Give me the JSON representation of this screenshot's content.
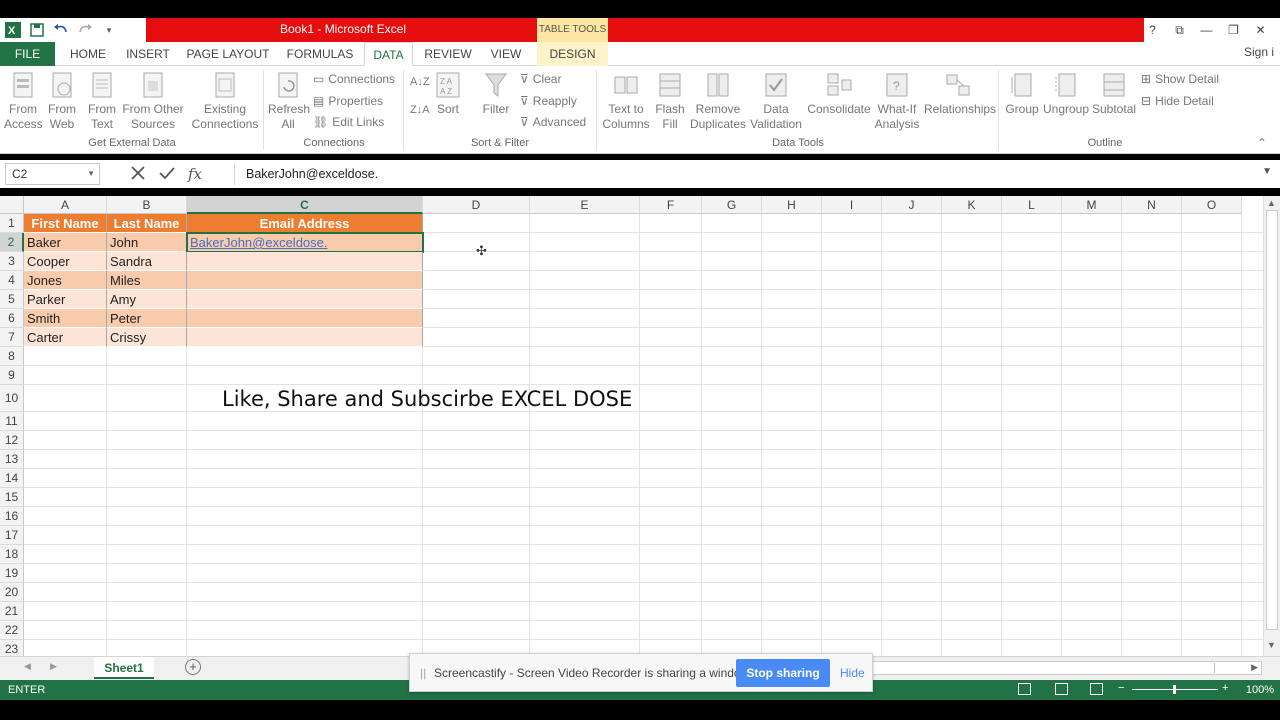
{
  "window": {
    "title": "Book1 -  Microsoft Excel",
    "context_tab_label": "TABLE TOOLS",
    "controls": [
      "?",
      "⧉",
      "—",
      "❐",
      "✕"
    ]
  },
  "tabs": {
    "file": "FILE",
    "home": "HOME",
    "insert": "INSERT",
    "page_layout": "PAGE LAYOUT",
    "formulas": "FORMULAS",
    "data": "DATA",
    "review": "REVIEW",
    "view": "VIEW",
    "design": "DESIGN",
    "signin": "Sign i"
  },
  "ribbon": {
    "get_external": {
      "from_access": "From Access",
      "from_web": "From Web",
      "from_text": "From Text",
      "from_other": "From Other Sources",
      "existing": "Existing Connections",
      "group": "Get External Data"
    },
    "connections": {
      "refresh": "Refresh All",
      "connections": "Connections",
      "properties": "Properties",
      "edit_links": "Edit Links",
      "group": "Connections"
    },
    "sort_filter": {
      "sort": "Sort",
      "filter": "Filter",
      "clear": "Clear",
      "reapply": "Reapply",
      "advanced": "Advanced",
      "group": "Sort & Filter"
    },
    "data_tools": {
      "text_to_columns": "Text to Columns",
      "flash_fill": "Flash Fill",
      "remove_duplicates": "Remove Duplicates",
      "data_validation": "Data Validation",
      "consolidate": "Consolidate",
      "what_if": "What-If Analysis",
      "relationships": "Relationships",
      "group": "Data Tools"
    },
    "outline": {
      "group_btn": "Group",
      "ungroup": "Ungroup",
      "subtotal": "Subtotal",
      "show_detail": "Show Detail",
      "hide_detail": "Hide Detail",
      "group": "Outline"
    }
  },
  "formula_bar": {
    "name_box": "C2",
    "content": "BakerJohn@exceldose."
  },
  "sheet": {
    "columns": [
      "A",
      "B",
      "C",
      "D",
      "E",
      "F",
      "G",
      "H",
      "I",
      "J",
      "K",
      "L",
      "M",
      "N",
      "O"
    ],
    "rows": [
      "1",
      "2",
      "3",
      "4",
      "5",
      "6",
      "7",
      "8",
      "9",
      "10",
      "11",
      "12",
      "13",
      "14",
      "15",
      "16",
      "17",
      "18",
      "19",
      "20",
      "21",
      "22",
      "23"
    ],
    "table": {
      "headers": [
        "First Name",
        "Last Name",
        "Email Address"
      ],
      "rows": [
        [
          "Baker",
          "John",
          "BakerJohn@exceldose."
        ],
        [
          "Cooper",
          "Sandra",
          ""
        ],
        [
          "Jones",
          "Miles",
          ""
        ],
        [
          "Parker",
          "Amy",
          ""
        ],
        [
          "Smith",
          "Peter",
          ""
        ],
        [
          "Carter",
          "Crissy",
          ""
        ]
      ]
    },
    "banner_text": "Like, Share and Subscirbe EXCEL DOSE",
    "active_tab": "Sheet1"
  },
  "status": {
    "mode": "ENTER",
    "zoom": "100%"
  },
  "screencastify": {
    "message": "Screencastify - Screen Video Recorder is sharing a window.",
    "stop": "Stop sharing",
    "hide": "Hide"
  },
  "colors": {
    "excel_green": "#217346",
    "table_header": "#ed7d31",
    "band_dark": "#f8cbad",
    "band_light": "#fce4d6",
    "title_red": "#e50d0d"
  }
}
